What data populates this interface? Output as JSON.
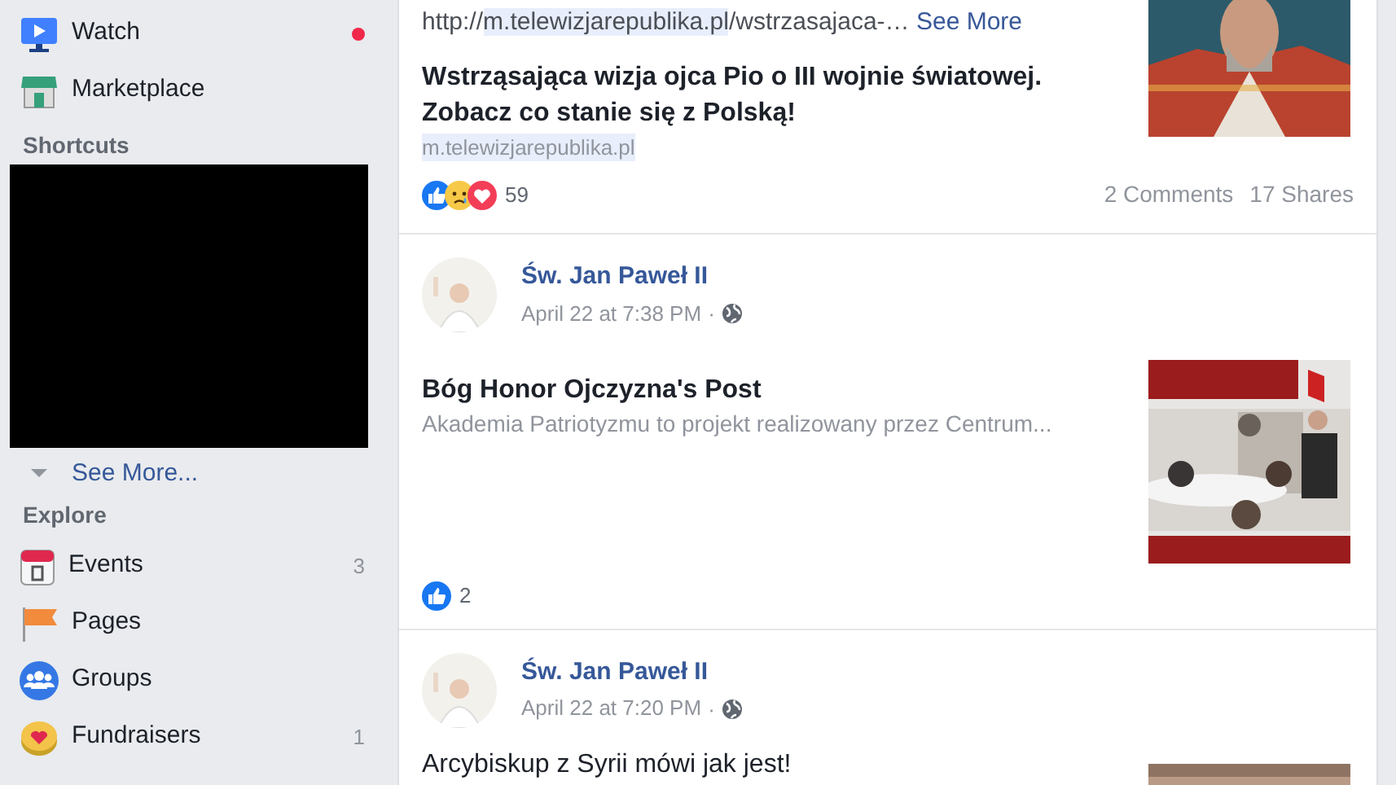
{
  "sidebar": {
    "top_items": [
      {
        "kind": "watch",
        "label": "Watch",
        "notification_dot": true
      },
      {
        "kind": "marketplace",
        "label": "Marketplace",
        "notification_dot": false
      }
    ],
    "shortcuts": {
      "heading": "Shortcuts",
      "see_more": "See More..."
    },
    "explore": {
      "heading": "Explore",
      "items": [
        {
          "kind": "events",
          "label": "Events",
          "count": "3"
        },
        {
          "kind": "pages",
          "label": "Pages"
        },
        {
          "kind": "groups",
          "label": "Groups"
        },
        {
          "kind": "fundraisers",
          "label": "Fundraisers",
          "count": "1"
        }
      ]
    }
  },
  "feed": [
    {
      "kind": "link",
      "link": {
        "prefix": "http://",
        "highlighted": "m.telewizjarepublika.pl",
        "rest": "/wstrzasajaca-…"
      },
      "see_more": "See More",
      "headline": "Wstrząsająca wizja ojca Pio o III wojnie światowej. Zobacz co stanie się z Polską!",
      "domain": "m.telewizjarepublika.pl",
      "reactions": [
        {
          "kind": "like"
        },
        {
          "kind": "sad"
        },
        {
          "kind": "love"
        }
      ],
      "reaction_count": "59",
      "comments": "2 Comments",
      "shares": "17 Shares"
    },
    {
      "kind": "shared",
      "author": "Św. Jan Paweł II",
      "time": "April 22 at 7:38 PM",
      "separator": "·",
      "headline": "Bóg Honor Ojczyzna's Post",
      "description": "Akademia Patriotyzmu to projekt realizowany przez Centrum...",
      "reactions": [
        {
          "kind": "like"
        }
      ],
      "reaction_count": "2"
    },
    {
      "kind": "text",
      "author": "Św. Jan Paweł II",
      "time": "April 22 at 7:20 PM",
      "separator": "·",
      "text": "Arcybiskup z Syrii mówi jak jest!"
    }
  ]
}
